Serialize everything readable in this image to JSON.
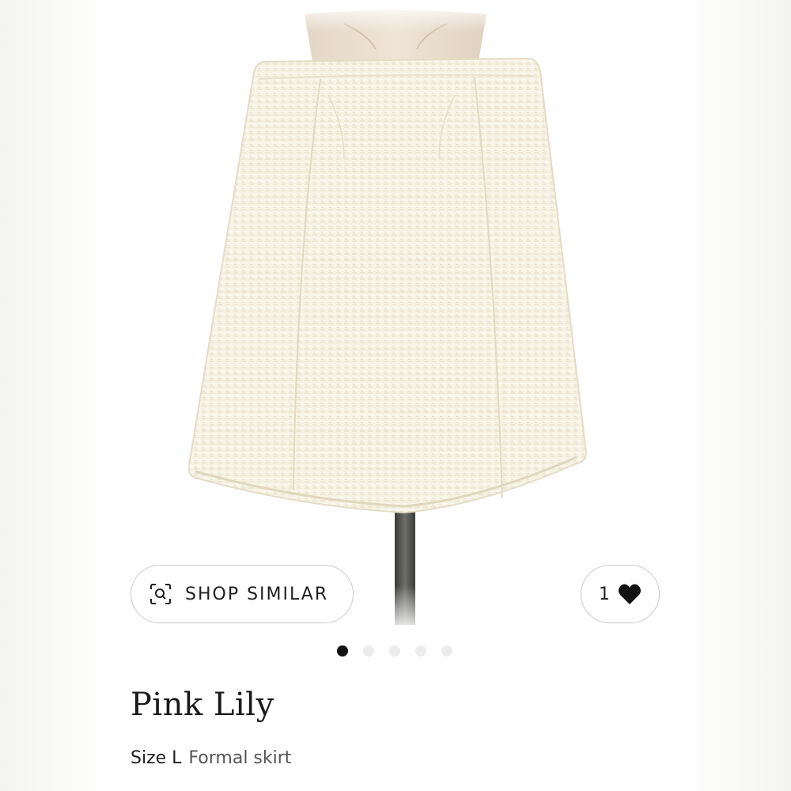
{
  "product": {
    "brand": "Pink Lily",
    "size_label": "Size L",
    "category": "Formal skirt",
    "image_subject": "cream tweed mini skirt on mannequin"
  },
  "actions": {
    "shop_similar_label": "SHOP SIMILAR",
    "shop_similar_icon": "visual-search-icon",
    "like_count": "1",
    "like_icon": "heart-icon"
  },
  "carousel": {
    "total": 5,
    "active_index": 0
  },
  "colors": {
    "text": "#1e1e1e",
    "border": "#c9c9c9",
    "dot_active": "#111111",
    "dot_inactive": "#ececec",
    "skirt": "#f5f1e3"
  }
}
